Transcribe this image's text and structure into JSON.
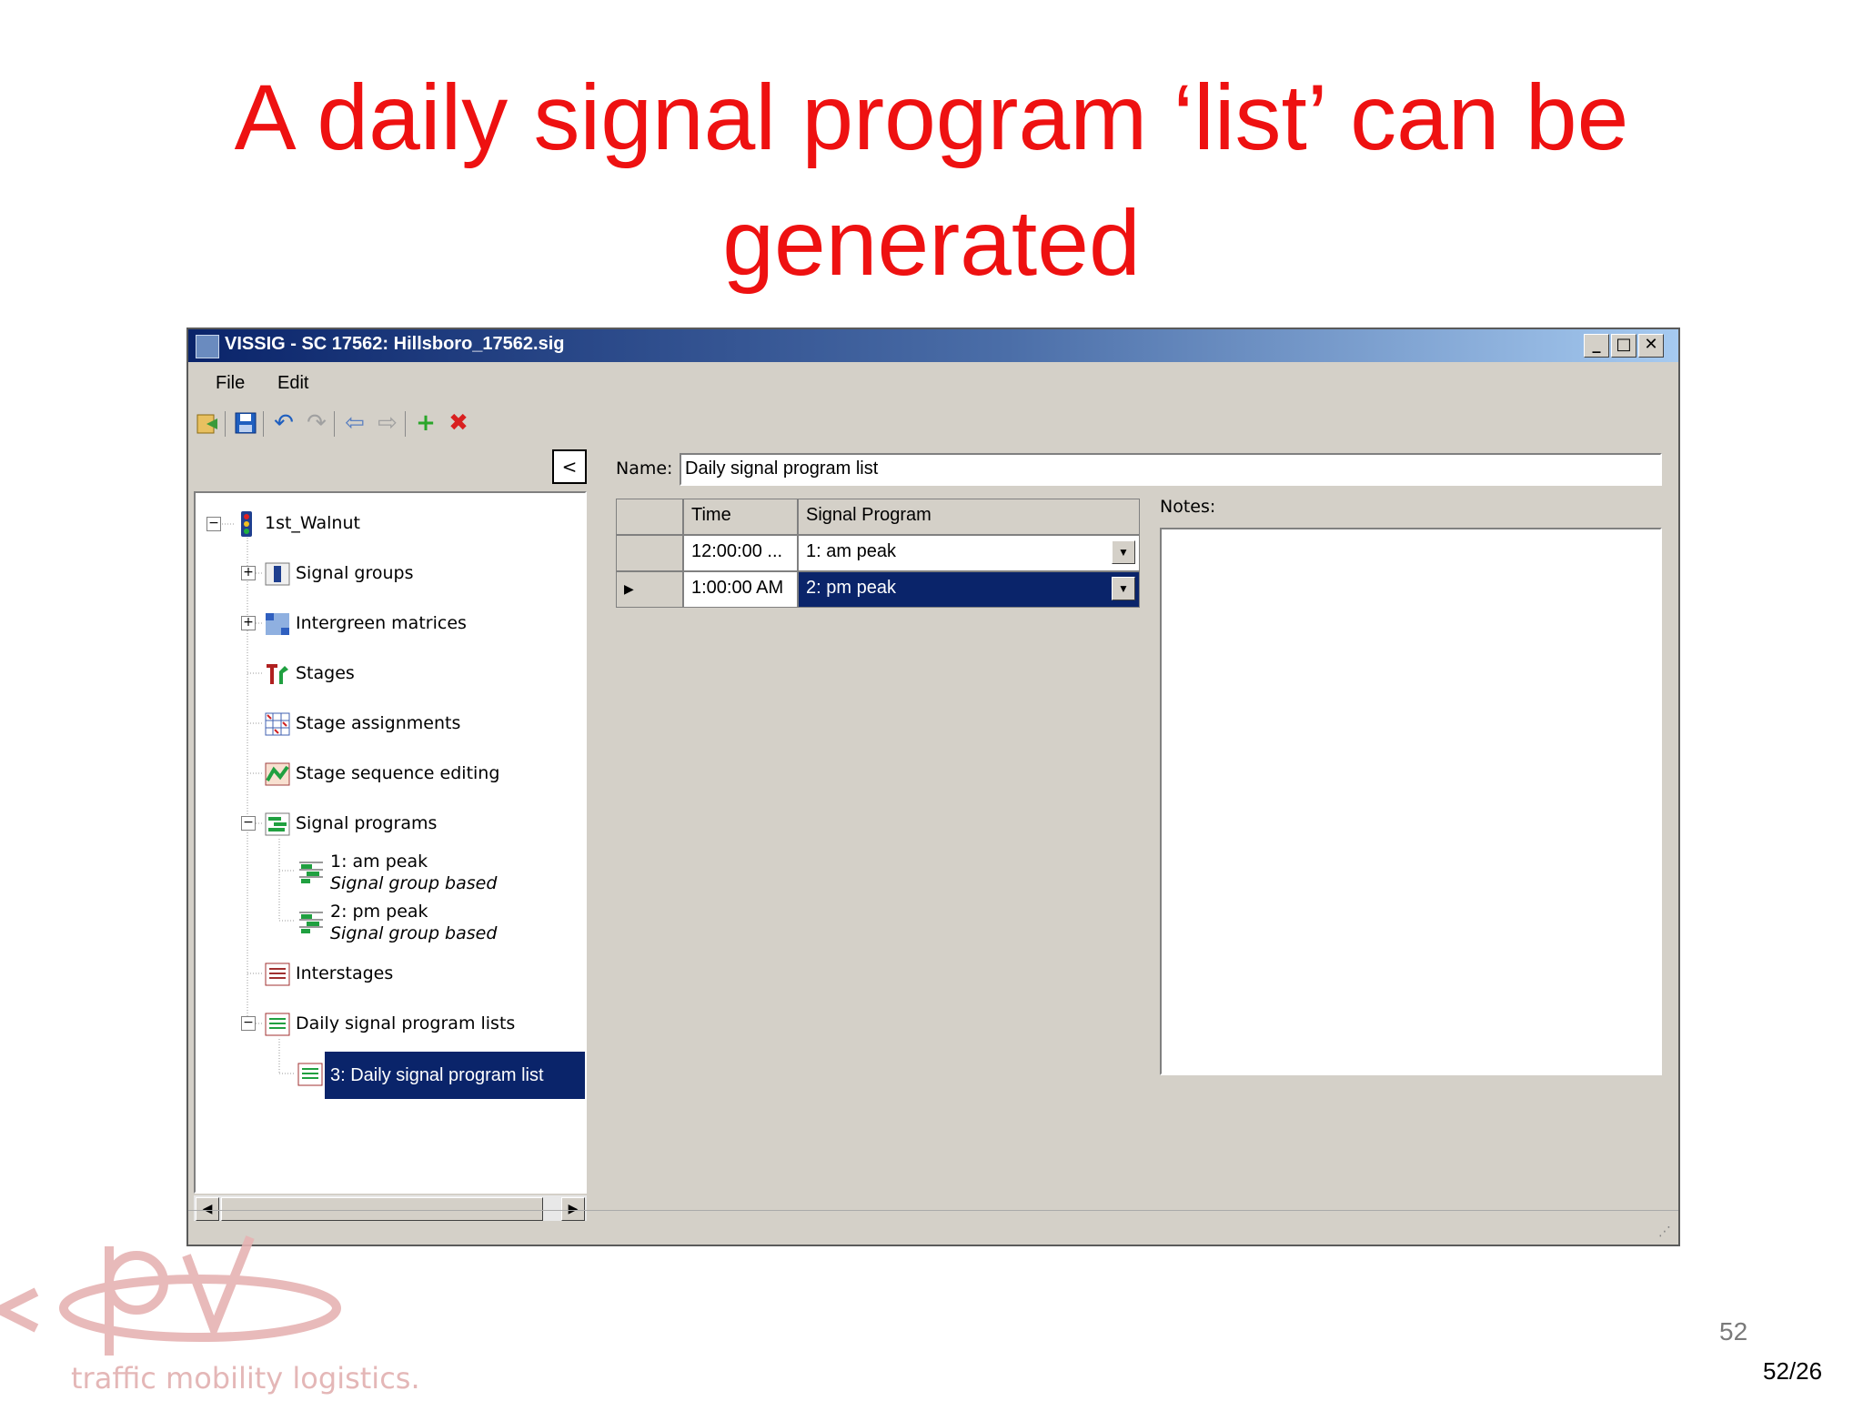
{
  "slide": {
    "title_line1": "A daily signal program ‘list’ can be",
    "title_line2": "generated",
    "page_number": "52",
    "page_count": "52/26",
    "logo_text": "traffic mobility logistics."
  },
  "window": {
    "title": "VISSIG - SC 17562: Hillsboro_17562.sig",
    "controls": {
      "minimize": "_",
      "maximize": "□",
      "close": "✕"
    }
  },
  "menu": {
    "file": "File",
    "edit": "Edit"
  },
  "toolbar_icons": [
    "open-icon",
    "save-icon",
    "undo-icon",
    "redo-icon",
    "back-icon",
    "forward-icon",
    "add-icon",
    "delete-icon"
  ],
  "left_panel": {
    "collapse_label": "<"
  },
  "tree": {
    "root": "1st_Walnut",
    "items": {
      "signal_groups": "Signal groups",
      "intergreen_matrices": "Intergreen matrices",
      "stages": "Stages",
      "stage_assignments": "Stage assignments",
      "stage_sequence_editing": "Stage sequence editing",
      "signal_programs": "Signal programs",
      "prog1_name": "1: am peak",
      "prog1_type": "Signal group based",
      "prog2_name": "2: pm peak",
      "prog2_type": "Signal group based",
      "interstages": "Interstages",
      "daily_lists": "Daily signal program lists",
      "daily_list1": "3: Daily signal program list"
    }
  },
  "detail": {
    "name_label": "Name:",
    "name_value": "Daily signal program list",
    "notes_label": "Notes:",
    "table": {
      "headers": [
        "",
        "Time",
        "Signal Program"
      ],
      "rows": [
        {
          "marker": "",
          "time": "12:00:00 ...",
          "program": "1: am peak"
        },
        {
          "marker": "▶",
          "time": "1:00:00 AM",
          "program": "2: pm peak"
        }
      ]
    }
  },
  "colors": {
    "title_red": "#ee1111",
    "selection": "#0a246a",
    "window_bg": "#d4d0c8"
  }
}
